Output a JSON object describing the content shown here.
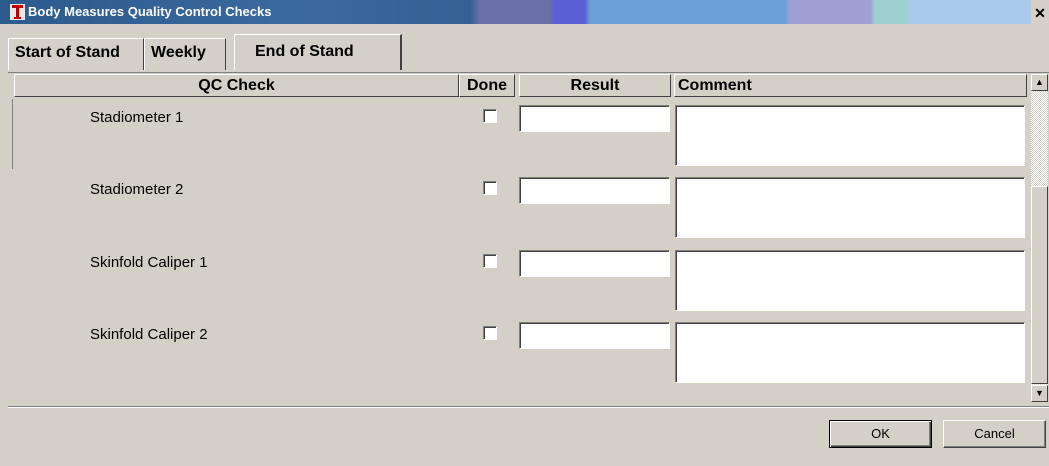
{
  "window": {
    "title": "Body Measures Quality Control Checks",
    "close_glyph": "✕"
  },
  "tabs": [
    {
      "label": "Start of Stand",
      "active": false
    },
    {
      "label": "Weekly",
      "active": false
    },
    {
      "label": "End of Stand",
      "active": true
    }
  ],
  "grid": {
    "headers": {
      "qc_check": "QC Check",
      "done": "Done",
      "result": "Result",
      "comment": "Comment"
    },
    "rows": [
      {
        "label": "Stadiometer 1",
        "done": false,
        "result": "",
        "comment": ""
      },
      {
        "label": "Stadiometer 2",
        "done": false,
        "result": "",
        "comment": ""
      },
      {
        "label": "Skinfold Caliper 1",
        "done": false,
        "result": "",
        "comment": ""
      },
      {
        "label": "Skinfold Caliper 2",
        "done": false,
        "result": "",
        "comment": ""
      }
    ]
  },
  "scrollbar": {
    "up_glyph": "▲",
    "down_glyph": "▼"
  },
  "buttons": {
    "ok": "OK",
    "cancel": "Cancel"
  },
  "colors": {
    "titlebar_start": "#2c5a8c",
    "dialog_bg": "#d4d0c8"
  }
}
